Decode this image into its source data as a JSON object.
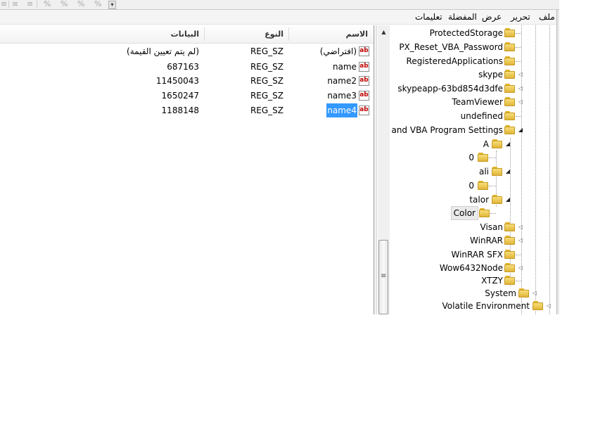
{
  "menubar": {
    "file": "ملف",
    "edit": "تحرير",
    "view": "عرض",
    "favorites": "المفضلة",
    "help": "تعليمات"
  },
  "list": {
    "headers": {
      "name": "الاسم",
      "type": "النوع",
      "data": "البيانات"
    },
    "rows": [
      {
        "name": "(افتراضي)",
        "type": "REG_SZ",
        "data": "(لم يتم تعيين القيمة)"
      },
      {
        "name": "name",
        "type": "REG_SZ",
        "data": "687163"
      },
      {
        "name": "name2",
        "type": "REG_SZ",
        "data": "11450043"
      },
      {
        "name": "name3",
        "type": "REG_SZ",
        "data": "1650247"
      },
      {
        "name": "name4",
        "type": "REG_SZ",
        "data": "1188148"
      }
    ],
    "selected_row": "name4",
    "value_icon": "ab"
  },
  "tree": {
    "items": [
      {
        "label": "ProtectedStorage"
      },
      {
        "label": "PX_Reset_VBA_Password"
      },
      {
        "label": "RegisteredApplications"
      },
      {
        "label": "skype"
      },
      {
        "label": "skypeapp-63bd854d3dfe"
      },
      {
        "label": "TeamViewer"
      },
      {
        "label": "undefined"
      },
      {
        "label": "VB and VBA Program Settings"
      },
      {
        "label": "A"
      },
      {
        "label": "0"
      },
      {
        "label": "ali"
      },
      {
        "label": "0"
      },
      {
        "label": "talor"
      },
      {
        "label": "Color"
      },
      {
        "label": "Visan"
      },
      {
        "label": "WinRAR"
      },
      {
        "label": "WinRAR SFX"
      },
      {
        "label": "Wow6432Node"
      },
      {
        "label": "XTZY"
      },
      {
        "label": "System"
      },
      {
        "label": "Volatile Environment"
      }
    ],
    "selected": "Color"
  },
  "icons": {
    "expander_closed": "◁",
    "expander_open": "◢",
    "scroll_up": "▲",
    "scroll_grip": "≡",
    "toolbar_more": "▾"
  },
  "colors": {
    "selection": "#3399ff",
    "folder": "#e8c14a",
    "value_icon_text": "#c00000"
  }
}
